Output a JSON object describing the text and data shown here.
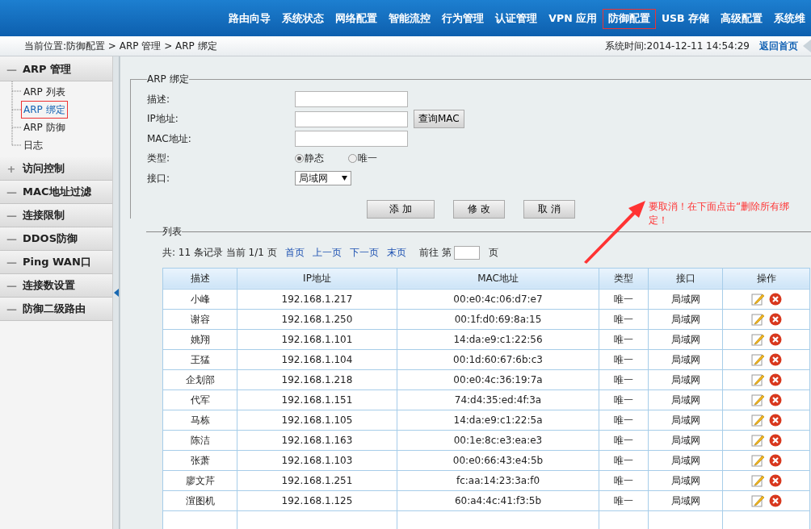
{
  "nav": [
    {
      "label": "路由向导",
      "selected": false
    },
    {
      "label": "系统状态",
      "selected": false
    },
    {
      "label": "网络配置",
      "selected": false
    },
    {
      "label": "智能流控",
      "selected": false
    },
    {
      "label": "行为管理",
      "selected": false
    },
    {
      "label": "认证管理",
      "selected": false
    },
    {
      "label": "VPN 应用",
      "selected": false
    },
    {
      "label": "防御配置",
      "selected": true
    },
    {
      "label": "USB 存储",
      "selected": false
    },
    {
      "label": "高级配置",
      "selected": false
    },
    {
      "label": "系统维",
      "selected": false
    }
  ],
  "breadcrumb": "当前位置:防御配置 > ARP 管理 > ARP 绑定",
  "system_time": "系统时间:2014-12-11 14:54:29",
  "home_link": "返回首页",
  "sidebar": [
    {
      "toggle": "—",
      "label": "ARP 管理",
      "children": [
        {
          "label": "ARP 列表",
          "selected": false
        },
        {
          "label": "ARP 绑定",
          "selected": true
        },
        {
          "label": "ARP 防御",
          "selected": false
        },
        {
          "label": "日志",
          "selected": false
        }
      ]
    },
    {
      "toggle": "+",
      "label": "访问控制"
    },
    {
      "toggle": "—",
      "label": "MAC地址过滤"
    },
    {
      "toggle": "—",
      "label": "连接限制"
    },
    {
      "toggle": "—",
      "label": "DDOS防御"
    },
    {
      "toggle": "—",
      "label": "Ping WAN口"
    },
    {
      "toggle": "—",
      "label": "连接数设置"
    },
    {
      "toggle": "—",
      "label": "防御二级路由"
    }
  ],
  "form": {
    "title": "ARP 绑定",
    "fields": [
      {
        "kind": "text",
        "label": "描述:"
      },
      {
        "kind": "text",
        "label": "IP地址:",
        "button": "查询MAC"
      },
      {
        "kind": "text",
        "label": "MAC地址:"
      },
      {
        "kind": "radio",
        "label": "类型:",
        "options": [
          {
            "label": "静态",
            "selected": true
          },
          {
            "label": "唯一",
            "selected": false
          }
        ]
      },
      {
        "kind": "select",
        "label": "接口:",
        "value": "局域网"
      }
    ],
    "buttons": [
      "添 加",
      "修 改",
      "取 消"
    ]
  },
  "annotation": "要取消！在下面点击“删除所有绑定！",
  "list": {
    "title": "列表",
    "summary": "共: 11 条记录 当前 1/1 页",
    "links": [
      "首页",
      "上一页",
      "下一页",
      "末页"
    ],
    "goto_label": "前往 第",
    "goto_suffix": "页",
    "columns": [
      "描述",
      "IP地址",
      "MAC地址",
      "类型",
      "接口",
      "操作"
    ],
    "rows": [
      [
        "小峰",
        "192.168.1.217",
        "00:e0:4c:06:d7:e7",
        "唯一",
        "局域网"
      ],
      [
        "谢容",
        "192.168.1.250",
        "00:1f:d0:69:8a:15",
        "唯一",
        "局域网"
      ],
      [
        "姚翔",
        "192.168.1.101",
        "14:da:e9:c1:22:56",
        "唯一",
        "局域网"
      ],
      [
        "王猛",
        "192.168.1.104",
        "00:1d:60:67:6b:c3",
        "唯一",
        "局域网"
      ],
      [
        "企划部",
        "192.168.1.218",
        "00:e0:4c:36:19:7a",
        "唯一",
        "局域网"
      ],
      [
        "代军",
        "192.168.1.151",
        "74:d4:35:ed:4f:3a",
        "唯一",
        "局域网"
      ],
      [
        "马栋",
        "192.168.1.105",
        "14:da:e9:c1:22:5a",
        "唯一",
        "局域网"
      ],
      [
        "陈洁",
        "192.168.1.163",
        "00:1e:8c:e3:ea:e3",
        "唯一",
        "局域网"
      ],
      [
        "张萧",
        "192.168.1.103",
        "00:e0:66:43:e4:5b",
        "唯一",
        "局域网"
      ],
      [
        "廖文芹",
        "192.168.1.251",
        "fc:aa:14:23:3a:f0",
        "唯一",
        "局域网"
      ],
      [
        "渲图机",
        "192.168.1.125",
        "60:a4:4c:41:f3:5b",
        "唯一",
        "局域网"
      ]
    ]
  }
}
